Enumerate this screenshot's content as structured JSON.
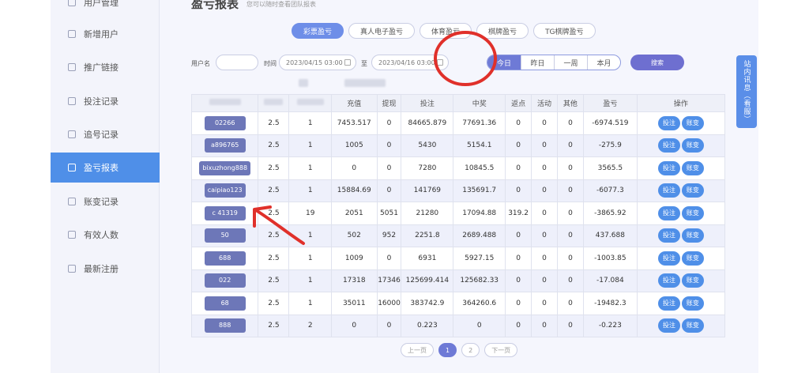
{
  "sidebar": {
    "items": [
      {
        "label": "用户管理"
      },
      {
        "label": "新增用户"
      },
      {
        "label": "推广链接"
      },
      {
        "label": "投注记录"
      },
      {
        "label": "追号记录"
      },
      {
        "label": "盈亏报表"
      },
      {
        "label": "账变记录"
      },
      {
        "label": "有效人数"
      },
      {
        "label": "最新注册"
      }
    ]
  },
  "header": {
    "title": "盈亏报表",
    "subtitle": "您可以随时查看团队报表"
  },
  "tabs": [
    {
      "label": "彩票盈亏"
    },
    {
      "label": "真人电子盈亏"
    },
    {
      "label": "体育盈亏"
    },
    {
      "label": "棋牌盈亏"
    },
    {
      "label": "TG棋牌盈亏"
    }
  ],
  "filters": {
    "username_label": "用户名",
    "time_label": "时间",
    "to_label": "至",
    "start_time": "2023/04/15 03:00",
    "end_time": "2023/04/16 03:00",
    "ranges": [
      "今日",
      "昨日",
      "一周",
      "本月"
    ],
    "search_label": "搜索"
  },
  "table": {
    "headers": [
      "",
      "",
      "",
      "充值",
      "提现",
      "投注",
      "中奖",
      "返点",
      "活动",
      "其他",
      "盈亏",
      "操作"
    ],
    "rows": [
      [
        "02266",
        "2.5",
        "1",
        "7453.517",
        "0",
        "84665.879",
        "77691.36",
        "0",
        "0",
        "0",
        "-6974.519"
      ],
      [
        "a896765",
        "2.5",
        "1",
        "1005",
        "0",
        "5430",
        "5154.1",
        "0",
        "0",
        "0",
        "-275.9"
      ],
      [
        "bixuzhong888",
        "2.5",
        "1",
        "0",
        "0",
        "7280",
        "10845.5",
        "0",
        "0",
        "0",
        "3565.5"
      ],
      [
        "caipiao123",
        "2.5",
        "1",
        "15884.69",
        "0",
        "141769",
        "135691.7",
        "0",
        "0",
        "0",
        "-6077.3"
      ],
      [
        "c 41319",
        "2.5",
        "19",
        "2051",
        "5051",
        "21280",
        "17094.88",
        "319.2",
        "0",
        "0",
        "-3865.92"
      ],
      [
        "50",
        "2.5",
        "1",
        "502",
        "952",
        "2251.8",
        "2689.488",
        "0",
        "0",
        "0",
        "437.688"
      ],
      [
        "688",
        "2.5",
        "1",
        "1009",
        "0",
        "6931",
        "5927.15",
        "0",
        "0",
        "0",
        "-1003.85"
      ],
      [
        "022",
        "2.5",
        "1",
        "17318",
        "17346",
        "125699.414",
        "125682.33",
        "0",
        "0",
        "0",
        "-17.084"
      ],
      [
        "68",
        "2.5",
        "1",
        "35011",
        "16000",
        "383742.9",
        "364260.6",
        "0",
        "0",
        "0",
        "-19482.3"
      ],
      [
        "888",
        "2.5",
        "2",
        "0",
        "0",
        "0.223",
        "0",
        "0",
        "0",
        "0",
        "-0.223"
      ]
    ],
    "action_bet": "投注",
    "action_change": "账变"
  },
  "pager": {
    "prev": "上一页",
    "page": "1",
    "page2": "2",
    "next": "下一页"
  },
  "float_tab": "站内讯息（看服）",
  "colors": {
    "accent": "#4f8fe8",
    "purple": "#6e7ad6",
    "annotation": "#e0302a"
  }
}
